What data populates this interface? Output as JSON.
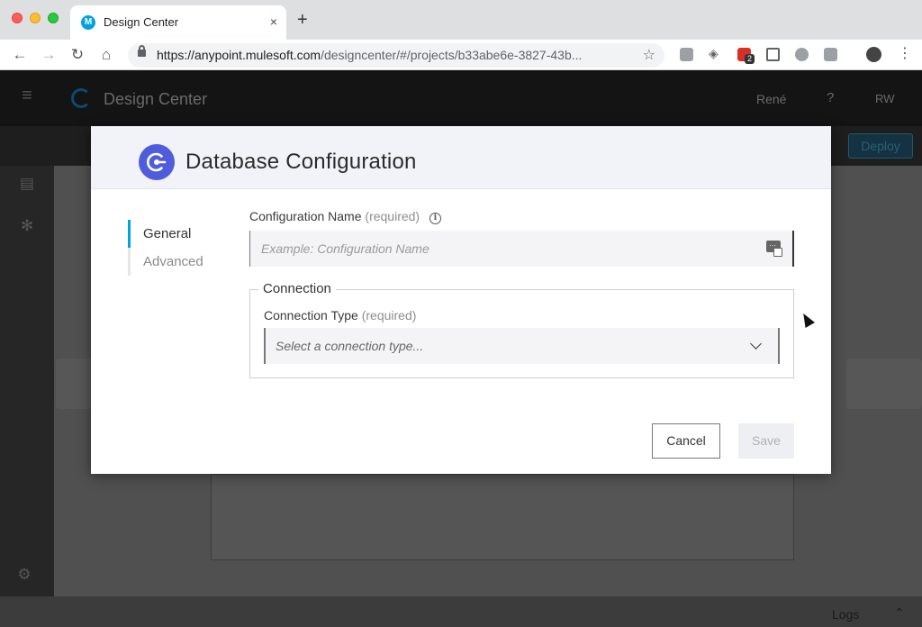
{
  "browser": {
    "tab_title": "Design Center",
    "url_host": "https://anypoint.mulesoft.com",
    "url_path": "/designcenter/#/projects/b33abe6e-3827-43b...",
    "extension_badge": "2",
    "tab_close_glyph": "×",
    "new_tab_glyph": "+"
  },
  "app": {
    "title": "Design Center",
    "user": "René",
    "help_glyph": "?",
    "initials": "RW",
    "deploy_label": "Deploy",
    "logs_label": "Logs"
  },
  "modal": {
    "title": "Database Configuration",
    "nav": [
      {
        "label": "General",
        "active": true
      },
      {
        "label": "Advanced",
        "active": false
      }
    ],
    "config_name": {
      "label": "Configuration Name",
      "required": "(required)",
      "placeholder": "Example: Configuration Name",
      "value": ""
    },
    "connection": {
      "legend": "Connection",
      "type_label": "Connection Type",
      "required": "(required)",
      "placeholder": "Select a connection type..."
    },
    "buttons": {
      "cancel": "Cancel",
      "save": "Save"
    }
  },
  "colors": {
    "accent": "#00a2df",
    "modal_icon": "#4f5ddc"
  },
  "icons": {
    "info": "info-icon",
    "variable": "variable-picker-icon",
    "chevron": "chevron-down-icon"
  }
}
